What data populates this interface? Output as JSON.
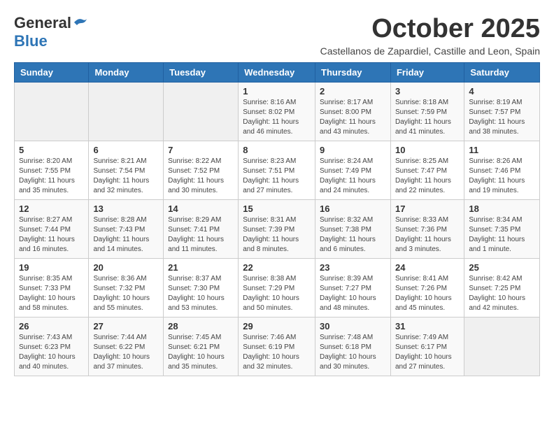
{
  "header": {
    "logo_general": "General",
    "logo_blue": "Blue",
    "month_year": "October 2025",
    "location": "Castellanos de Zapardiel, Castille and Leon, Spain"
  },
  "days_of_week": [
    "Sunday",
    "Monday",
    "Tuesday",
    "Wednesday",
    "Thursday",
    "Friday",
    "Saturday"
  ],
  "weeks": [
    [
      {
        "day": "",
        "info": ""
      },
      {
        "day": "",
        "info": ""
      },
      {
        "day": "",
        "info": ""
      },
      {
        "day": "1",
        "info": "Sunrise: 8:16 AM\nSunset: 8:02 PM\nDaylight: 11 hours and 46 minutes."
      },
      {
        "day": "2",
        "info": "Sunrise: 8:17 AM\nSunset: 8:00 PM\nDaylight: 11 hours and 43 minutes."
      },
      {
        "day": "3",
        "info": "Sunrise: 8:18 AM\nSunset: 7:59 PM\nDaylight: 11 hours and 41 minutes."
      },
      {
        "day": "4",
        "info": "Sunrise: 8:19 AM\nSunset: 7:57 PM\nDaylight: 11 hours and 38 minutes."
      }
    ],
    [
      {
        "day": "5",
        "info": "Sunrise: 8:20 AM\nSunset: 7:55 PM\nDaylight: 11 hours and 35 minutes."
      },
      {
        "day": "6",
        "info": "Sunrise: 8:21 AM\nSunset: 7:54 PM\nDaylight: 11 hours and 32 minutes."
      },
      {
        "day": "7",
        "info": "Sunrise: 8:22 AM\nSunset: 7:52 PM\nDaylight: 11 hours and 30 minutes."
      },
      {
        "day": "8",
        "info": "Sunrise: 8:23 AM\nSunset: 7:51 PM\nDaylight: 11 hours and 27 minutes."
      },
      {
        "day": "9",
        "info": "Sunrise: 8:24 AM\nSunset: 7:49 PM\nDaylight: 11 hours and 24 minutes."
      },
      {
        "day": "10",
        "info": "Sunrise: 8:25 AM\nSunset: 7:47 PM\nDaylight: 11 hours and 22 minutes."
      },
      {
        "day": "11",
        "info": "Sunrise: 8:26 AM\nSunset: 7:46 PM\nDaylight: 11 hours and 19 minutes."
      }
    ],
    [
      {
        "day": "12",
        "info": "Sunrise: 8:27 AM\nSunset: 7:44 PM\nDaylight: 11 hours and 16 minutes."
      },
      {
        "day": "13",
        "info": "Sunrise: 8:28 AM\nSunset: 7:43 PM\nDaylight: 11 hours and 14 minutes."
      },
      {
        "day": "14",
        "info": "Sunrise: 8:29 AM\nSunset: 7:41 PM\nDaylight: 11 hours and 11 minutes."
      },
      {
        "day": "15",
        "info": "Sunrise: 8:31 AM\nSunset: 7:39 PM\nDaylight: 11 hours and 8 minutes."
      },
      {
        "day": "16",
        "info": "Sunrise: 8:32 AM\nSunset: 7:38 PM\nDaylight: 11 hours and 6 minutes."
      },
      {
        "day": "17",
        "info": "Sunrise: 8:33 AM\nSunset: 7:36 PM\nDaylight: 11 hours and 3 minutes."
      },
      {
        "day": "18",
        "info": "Sunrise: 8:34 AM\nSunset: 7:35 PM\nDaylight: 11 hours and 1 minute."
      }
    ],
    [
      {
        "day": "19",
        "info": "Sunrise: 8:35 AM\nSunset: 7:33 PM\nDaylight: 10 hours and 58 minutes."
      },
      {
        "day": "20",
        "info": "Sunrise: 8:36 AM\nSunset: 7:32 PM\nDaylight: 10 hours and 55 minutes."
      },
      {
        "day": "21",
        "info": "Sunrise: 8:37 AM\nSunset: 7:30 PM\nDaylight: 10 hours and 53 minutes."
      },
      {
        "day": "22",
        "info": "Sunrise: 8:38 AM\nSunset: 7:29 PM\nDaylight: 10 hours and 50 minutes."
      },
      {
        "day": "23",
        "info": "Sunrise: 8:39 AM\nSunset: 7:27 PM\nDaylight: 10 hours and 48 minutes."
      },
      {
        "day": "24",
        "info": "Sunrise: 8:41 AM\nSunset: 7:26 PM\nDaylight: 10 hours and 45 minutes."
      },
      {
        "day": "25",
        "info": "Sunrise: 8:42 AM\nSunset: 7:25 PM\nDaylight: 10 hours and 42 minutes."
      }
    ],
    [
      {
        "day": "26",
        "info": "Sunrise: 7:43 AM\nSunset: 6:23 PM\nDaylight: 10 hours and 40 minutes."
      },
      {
        "day": "27",
        "info": "Sunrise: 7:44 AM\nSunset: 6:22 PM\nDaylight: 10 hours and 37 minutes."
      },
      {
        "day": "28",
        "info": "Sunrise: 7:45 AM\nSunset: 6:21 PM\nDaylight: 10 hours and 35 minutes."
      },
      {
        "day": "29",
        "info": "Sunrise: 7:46 AM\nSunset: 6:19 PM\nDaylight: 10 hours and 32 minutes."
      },
      {
        "day": "30",
        "info": "Sunrise: 7:48 AM\nSunset: 6:18 PM\nDaylight: 10 hours and 30 minutes."
      },
      {
        "day": "31",
        "info": "Sunrise: 7:49 AM\nSunset: 6:17 PM\nDaylight: 10 hours and 27 minutes."
      },
      {
        "day": "",
        "info": ""
      }
    ]
  ]
}
